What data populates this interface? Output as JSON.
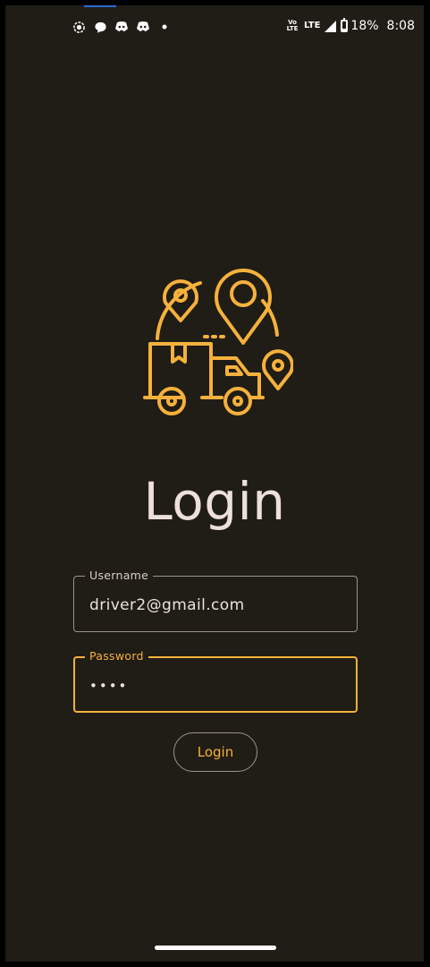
{
  "status_bar": {
    "left_icons": [
      "screen-record-icon",
      "chat-bubble-icon",
      "discord-icon",
      "discord-icon",
      "notification-dot-icon"
    ],
    "volte_label": "Vo LTE",
    "network_label": "LTE",
    "battery_percent": "18%",
    "time": "8:08"
  },
  "logo": {
    "icon": "delivery-truck-with-location-pins-icon",
    "color": "#f6b13c"
  },
  "login": {
    "title": "Login",
    "username_label": "Username",
    "username_value": "driver2@gmail.com",
    "password_label": "Password",
    "password_value": "••••",
    "submit_label": "Login"
  },
  "colors": {
    "background": "#201d16",
    "accent": "#f6b13c",
    "title_text": "#ede0dc",
    "outline": "#9a948d"
  }
}
